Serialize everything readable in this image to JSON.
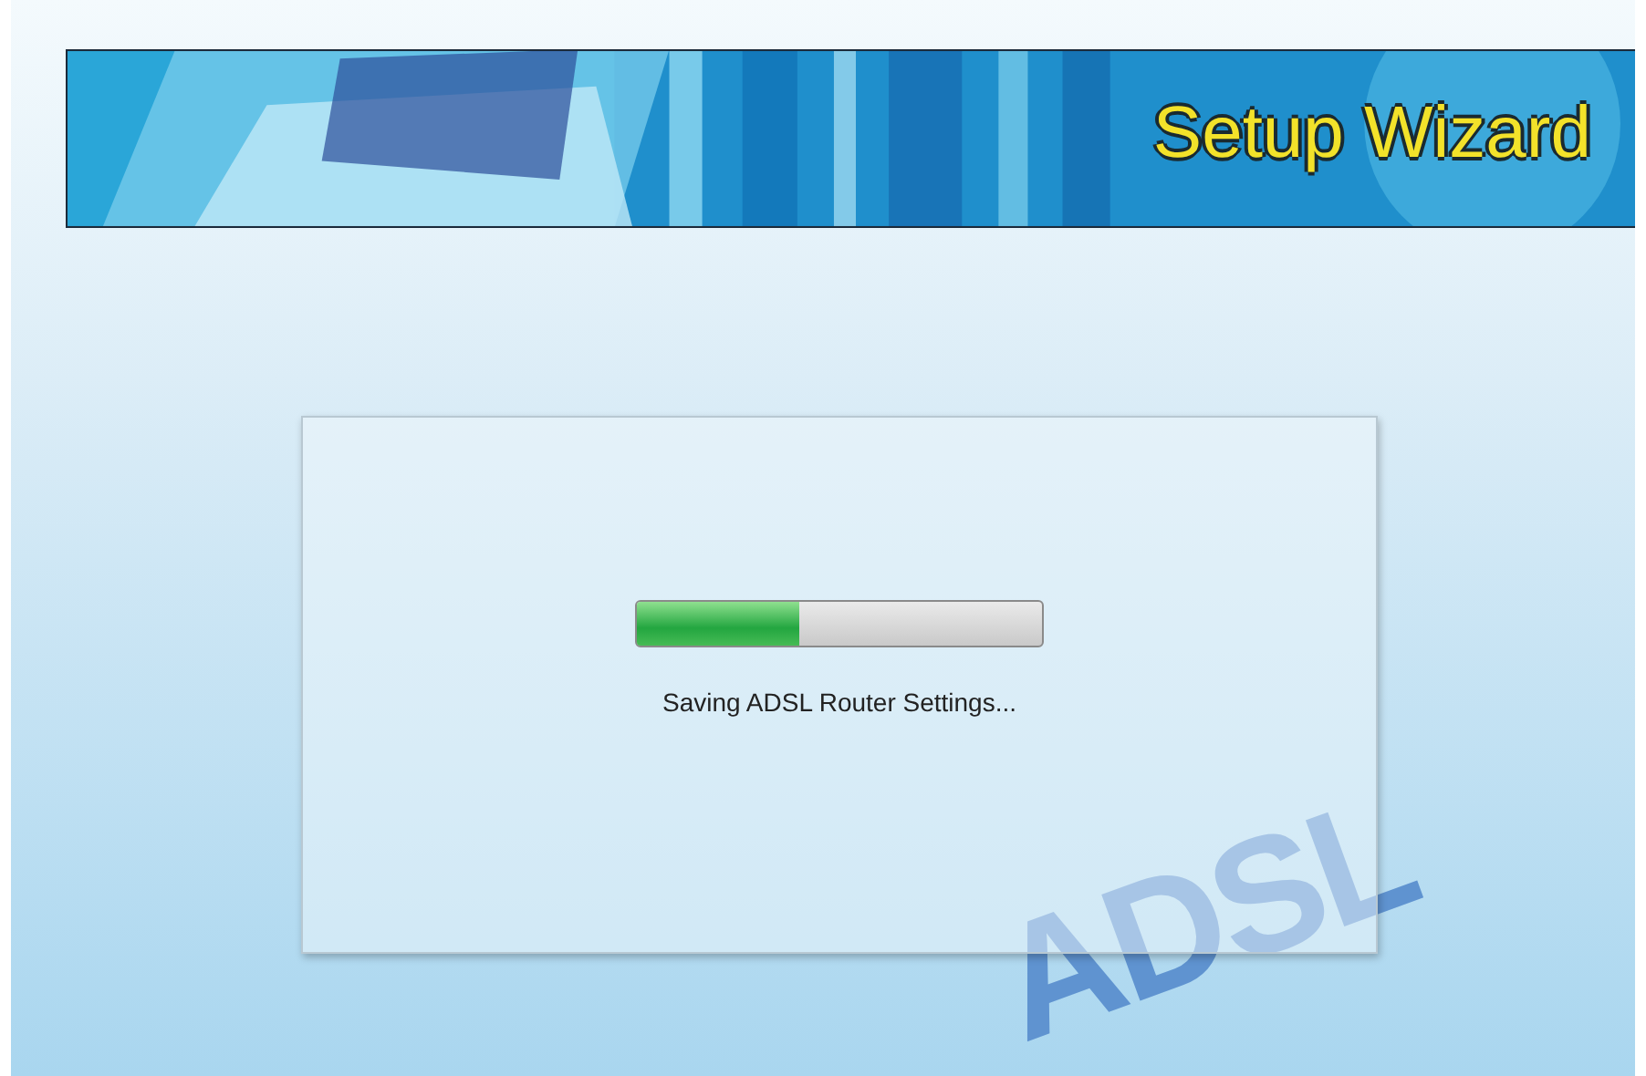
{
  "banner": {
    "title": "Setup Wizard",
    "kind": "picture"
  },
  "background_logo": "ADSL",
  "dialog": {
    "progress": {
      "level": 0.4
    },
    "message": "Saving ADSL Router Settings..."
  }
}
